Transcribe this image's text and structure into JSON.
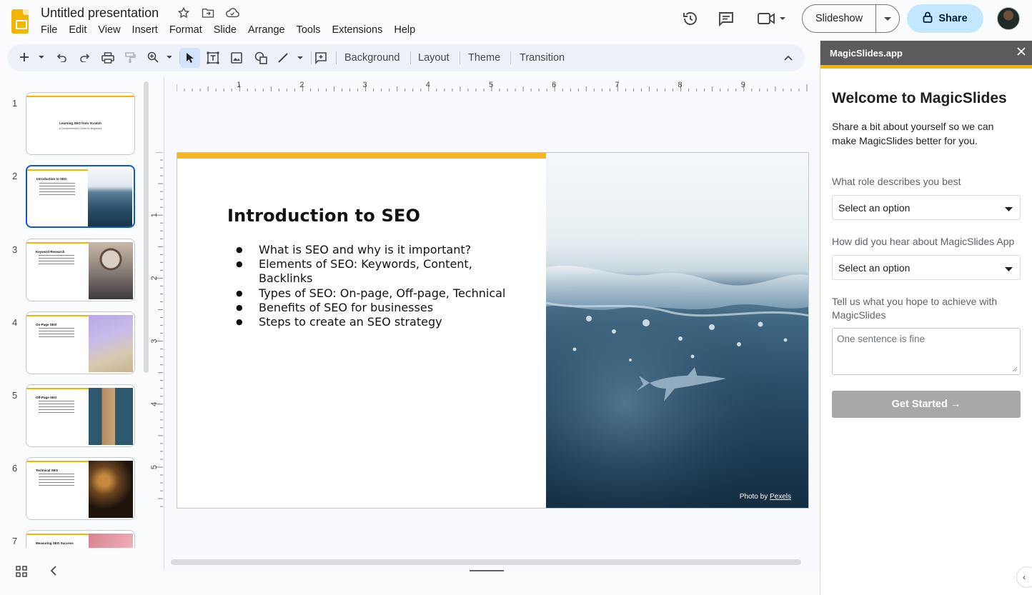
{
  "app": {
    "title": "Untitled presentation",
    "menu": [
      "File",
      "Edit",
      "View",
      "Insert",
      "Format",
      "Slide",
      "Arrange",
      "Tools",
      "Extensions",
      "Help"
    ],
    "icons": [
      "star-icon",
      "move-to-folder-icon",
      "cloud-saved-icon"
    ]
  },
  "header": {
    "slideshow_label": "Slideshow",
    "share_label": "Share"
  },
  "toolbar": {
    "background_label": "Background",
    "layout_label": "Layout",
    "theme_label": "Theme",
    "transition_label": "Transition"
  },
  "ruler": {
    "top": [
      "1",
      "2",
      "3",
      "4",
      "5",
      "6",
      "7",
      "8",
      "9"
    ],
    "left": [
      "1",
      "2",
      "3",
      "4",
      "5"
    ]
  },
  "filmstrip": {
    "slides": [
      {
        "num": "1",
        "title": "Learning SEO from Scratch",
        "subtitle": "A Comprehensive Guide for Beginners"
      },
      {
        "num": "2",
        "title": "Introduction to SEO"
      },
      {
        "num": "3",
        "title": "Keyword Research"
      },
      {
        "num": "4",
        "title": "On-Page SEO"
      },
      {
        "num": "5",
        "title": "Off-Page SEO"
      },
      {
        "num": "6",
        "title": "Technical SEO"
      },
      {
        "num": "7",
        "title": "Measuring SEO Success"
      }
    ]
  },
  "slide": {
    "title": "Introduction to SEO",
    "bullets": [
      "What is SEO and why is it important?",
      "Elements of SEO: Keywords, Content, Backlinks",
      "Types of SEO: On-page, Off-page, Technical",
      "Benefits of SEO for businesses",
      "Steps to create an SEO strategy"
    ],
    "photo_credit_prefix": "Photo by",
    "photo_credit_link": "Pexels",
    "accent_color": "#f6b622"
  },
  "sidepanel": {
    "header": "MagicSlides.app",
    "title": "Welcome to MagicSlides",
    "intro": "Share a bit about yourself so we can make MagicSlides better for you.",
    "role_label": "What role describes you best",
    "role_value": "Select an option",
    "source_label": "How did you hear about MagicSlides App",
    "source_value": "Select an option",
    "goal_label": "Tell us what you hope to achieve with MagicSlides",
    "goal_placeholder": "One sentence is fine",
    "cta_label": "Get Started →"
  },
  "colors": {
    "accent_yellow": "#f4b400",
    "share_bg": "#c2e7ff",
    "selection_blue": "#0b57d0"
  }
}
